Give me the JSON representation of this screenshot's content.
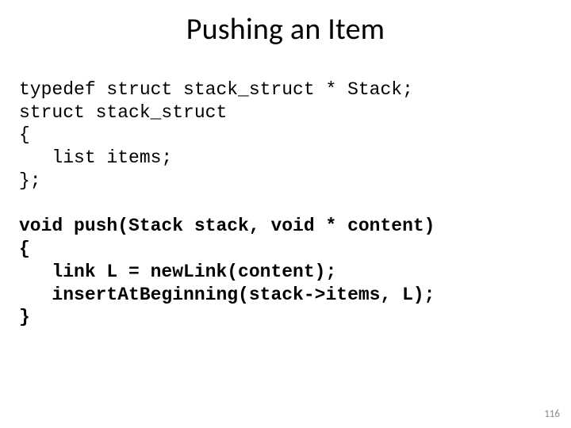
{
  "title": "Pushing an Item",
  "code": {
    "block1": {
      "l1": "typedef struct stack_struct * Stack;",
      "l2": "struct stack_struct",
      "l3": "{",
      "l4": "   list items;",
      "l5": "};"
    },
    "block2": {
      "l1": "void push(Stack stack, void * content)",
      "l2": "{",
      "l3": "   link L = newLink(content);",
      "l4": "   insertAtBeginning(stack->items, L);",
      "l5": "}"
    }
  },
  "page_number": "116"
}
